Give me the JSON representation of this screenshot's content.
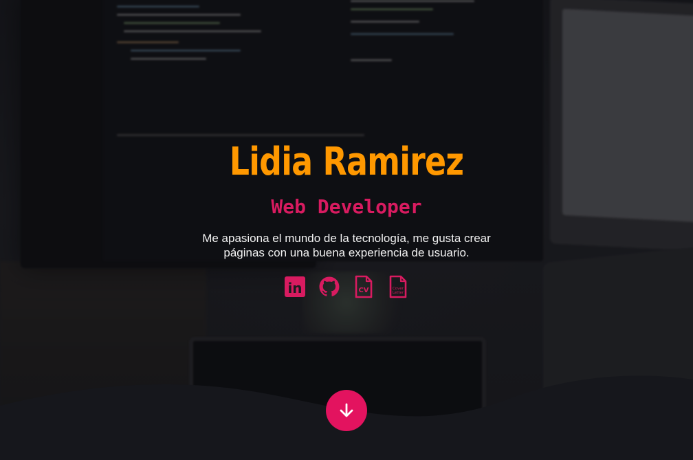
{
  "hero": {
    "name": "Lidia Ramirez",
    "role": "Web Developer",
    "bio": "Me apasiona el mundo de la tecnología, me gusta crear páginas con una buena experiencia de usuario."
  },
  "socials": [
    {
      "icon": "linkedin-icon",
      "label": "in"
    },
    {
      "icon": "github-icon"
    },
    {
      "icon": "cv-document-icon",
      "label": "CV"
    },
    {
      "icon": "cover-letter-document-icon",
      "label": "Cover Letter"
    }
  ],
  "scroll_button": {
    "icon": "arrow-down-icon"
  },
  "colors": {
    "name": "#ff9800",
    "accent": "#d81b60",
    "button": "#e3135f",
    "wave": "#16171c"
  }
}
